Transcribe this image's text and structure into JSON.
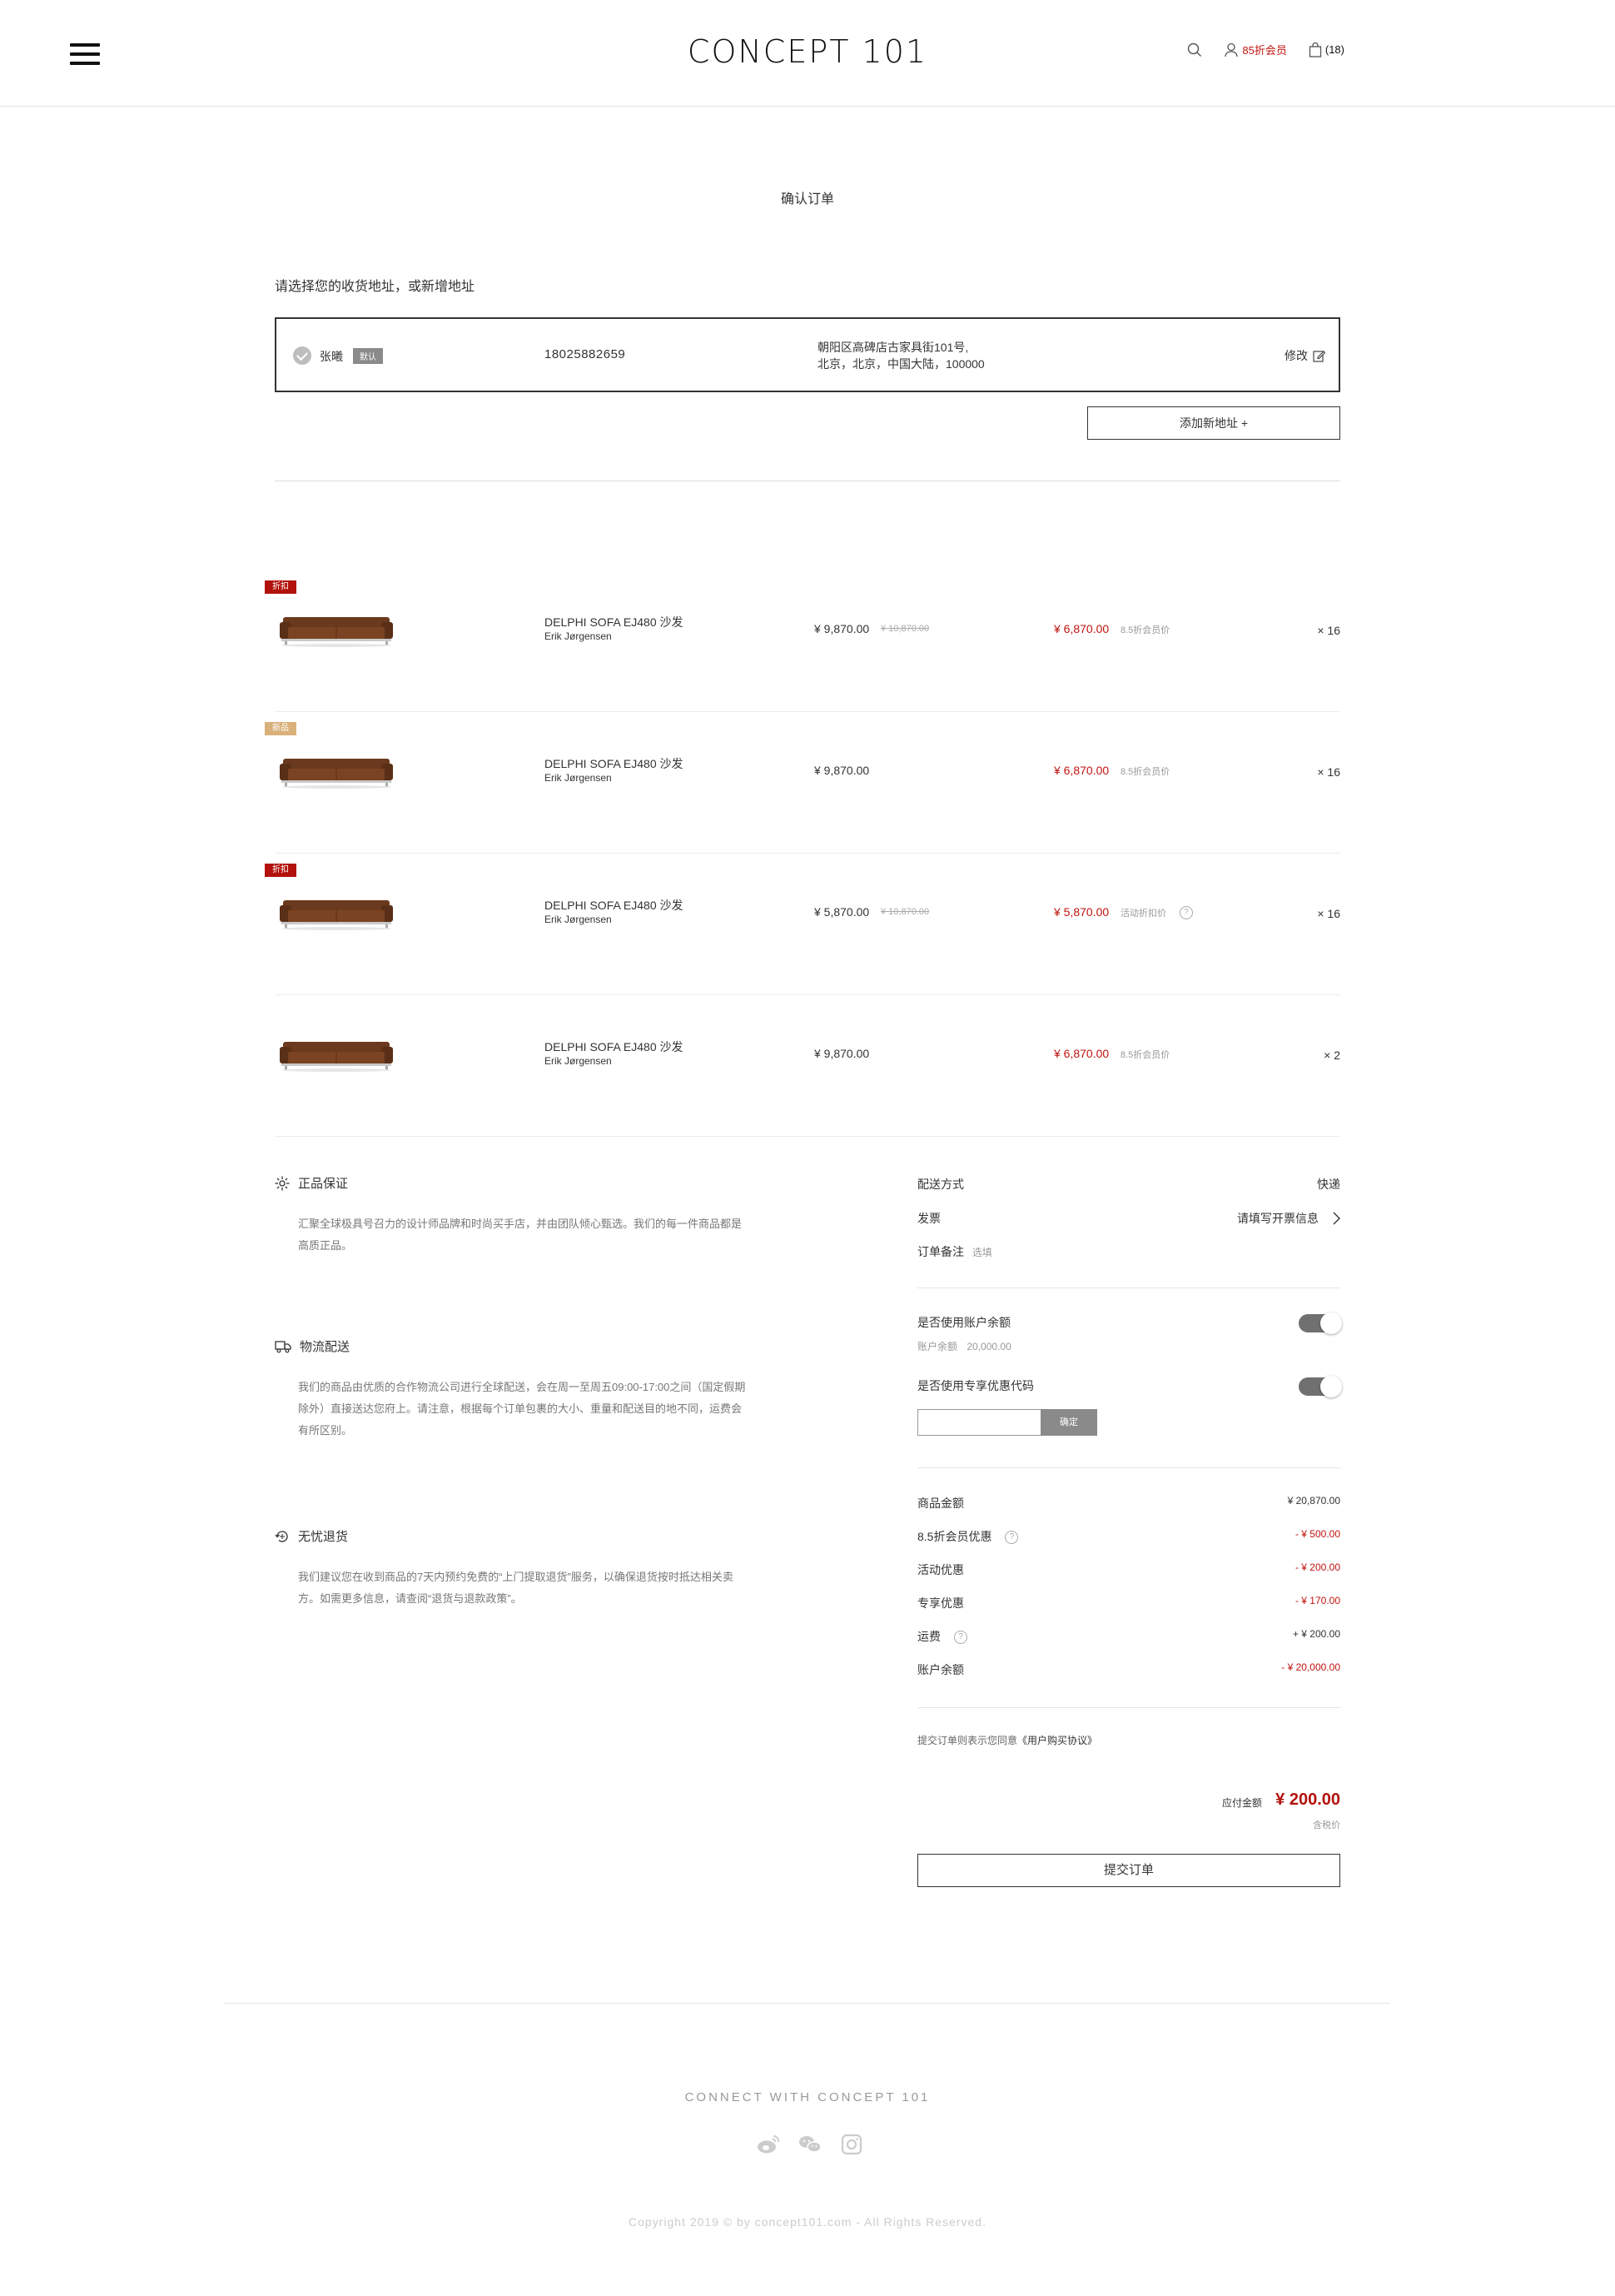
{
  "header": {
    "logo": "CONCEPT 101",
    "member_label": "85折会员",
    "cart_count": "(18)"
  },
  "page": {
    "title": "确认订单",
    "address_prompt": "请选择您的收货地址，或新增地址"
  },
  "address": {
    "name": "张曦",
    "default_tag": "默认",
    "phone": "18025882659",
    "line1": "朝阳区高碑店古家具街101号,",
    "line2": "北京，北京，中国大陆，100000",
    "edit_label": "修改"
  },
  "add_address_label": "添加新地址 +",
  "products": [
    {
      "badge": "折扣",
      "badge_color": "#b3120c",
      "name": "DELPHI SOFA EJ480 沙发",
      "designer": "Erik Jørgensen",
      "price": "¥ 9,870.00",
      "orig_price": "¥ 10,870.00",
      "disc_price": "¥ 6,870.00",
      "disc_note": "8.5折会员价",
      "qty": "× 16"
    },
    {
      "badge": "新品",
      "badge_color": "#d9b07a",
      "name": "DELPHI SOFA EJ480 沙发",
      "designer": "Erik Jørgensen",
      "price": "¥ 9,870.00",
      "orig_price": "",
      "disc_price": "¥ 6,870.00",
      "disc_note": "8.5折会员价",
      "qty": "× 16"
    },
    {
      "badge": "折扣",
      "badge_color": "#b3120c",
      "name": "DELPHI SOFA EJ480 沙发",
      "designer": "Erik Jørgensen",
      "price": "¥ 5,870.00",
      "orig_price": "¥ 10,870.00",
      "disc_price": "¥ 5,870.00",
      "disc_note": "活动折扣价",
      "qty": "× 16"
    },
    {
      "badge": "",
      "badge_color": "",
      "name": "DELPHI SOFA EJ480 沙发",
      "designer": "Erik Jørgensen",
      "price": "¥ 9,870.00",
      "orig_price": "",
      "disc_price": "¥ 6,870.00",
      "disc_note": "8.5折会员价",
      "qty": "× 2"
    }
  ],
  "info": {
    "genuine_title": "正品保证",
    "genuine_text": "汇聚全球极具号召力的设计师品牌和时尚买手店，并由团队倾心甄选。我们的每一件商品都是高质正品。",
    "logistics_title": "物流配送",
    "logistics_text": "我们的商品由优质的合作物流公司进行全球配送，会在周一至周五09:00-17:00之间（国定假期除外）直接送达您府上。请注意，根据每个订单包裹的大小、重量和配送目的地不同，运费会有所区别。",
    "return_title": "无忧退货",
    "return_text": "我们建议您在收到商品的7天内预约免费的“上门提取退货”服务，以确保退货按时抵达相关卖方。如需更多信息，请查阅“退货与退款政策”。"
  },
  "summary": {
    "delivery_label": "配送方式",
    "delivery_value": "快递",
    "invoice_label": "发票",
    "invoice_value": "请填写开票信息",
    "note_label": "订单备注",
    "note_hint": "选填",
    "balance_toggle_label": "是否使用账户余额",
    "balance_sub": "账户余额",
    "balance_amount": "20,000.00",
    "coupon_toggle_label": "是否使用专享优惠代码",
    "coupon_btn": "确定",
    "lines": [
      {
        "label": "商品金额",
        "value": "¥ 20,870.00",
        "help": false,
        "tone": "pos"
      },
      {
        "label": "8.5折会员优惠",
        "value": "- ¥ 500.00",
        "help": true,
        "tone": "neg"
      },
      {
        "label": "活动优惠",
        "value": "- ¥ 200.00",
        "help": false,
        "tone": "neg"
      },
      {
        "label": "专享优惠",
        "value": "- ¥ 170.00",
        "help": false,
        "tone": "neg"
      },
      {
        "label": "运费",
        "value": "+ ¥ 200.00",
        "help": true,
        "tone": "pos"
      },
      {
        "label": "账户余额",
        "value": "- ¥ 20,000.00",
        "help": false,
        "tone": "neg"
      }
    ],
    "agree_prefix": "提交订单则表示您同意",
    "agree_link": "《用户购买协议》",
    "pay_label": "应付金额",
    "pay_total": "¥ 200.00",
    "tax_note": "含税价",
    "submit_label": "提交订单"
  },
  "footer": {
    "connect": "CONNECT WITH CONCEPT 101",
    "copyright": "Copyright 2019 © by concept101.com - All Rights Reserved."
  },
  "colors": {
    "accent_red": "#c0140f",
    "badge_red": "#b3120c",
    "badge_tan": "#d9b07a"
  }
}
